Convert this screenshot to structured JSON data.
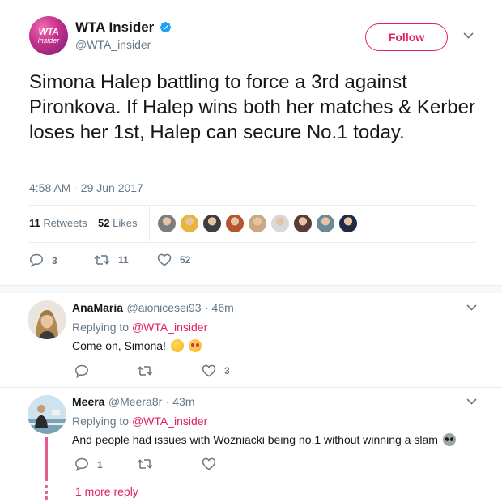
{
  "main_tweet": {
    "author_name": "WTA Insider",
    "author_handle": "@WTA_insider",
    "avatar_text_top": "WTA",
    "avatar_text_bottom": "insider",
    "follow_label": "Follow",
    "text": "Simona Halep battling to force a 3rd against Pironkova. If Halep wins both her matches & Kerber loses her 1st, Halep can secure No.1 today.",
    "timestamp": "4:58 AM - 29 Jun 2017",
    "retweets_count": "11",
    "retweets_label": "Retweets",
    "likes_count": "52",
    "likes_label": "Likes",
    "actions": {
      "replies": "3",
      "retweets": "11",
      "likes": "52"
    },
    "liker_colors": [
      "#7d7d7d",
      "#e8b53a",
      "#3e3e3e",
      "#b5552e",
      "#c9a884",
      "#d9d9d9",
      "#5a3a3a",
      "#6a8a9a",
      "#1f2a44"
    ]
  },
  "replies": [
    {
      "name": "AnaMaria",
      "handle": "@aionicesei93",
      "time": "· 46m",
      "replying_prefix": "Replying to",
      "replying_to": "@WTA_insider",
      "text": "Come on, Simona!",
      "actions": {
        "replies": "",
        "retweets": "",
        "likes": "3"
      }
    },
    {
      "name": "Meera",
      "handle": "@Meera8r",
      "time": "· 43m",
      "replying_prefix": "Replying to",
      "replying_to": "@WTA_insider",
      "text": "And people had issues with Wozniacki being no.1 without winning a slam",
      "actions": {
        "replies": "1",
        "retweets": "",
        "likes": ""
      },
      "more_replies": "1 more reply"
    }
  ],
  "colors": {
    "accent": "#e0245e",
    "verified": "#1da1f2",
    "muted": "#657786",
    "text": "#14171a"
  }
}
